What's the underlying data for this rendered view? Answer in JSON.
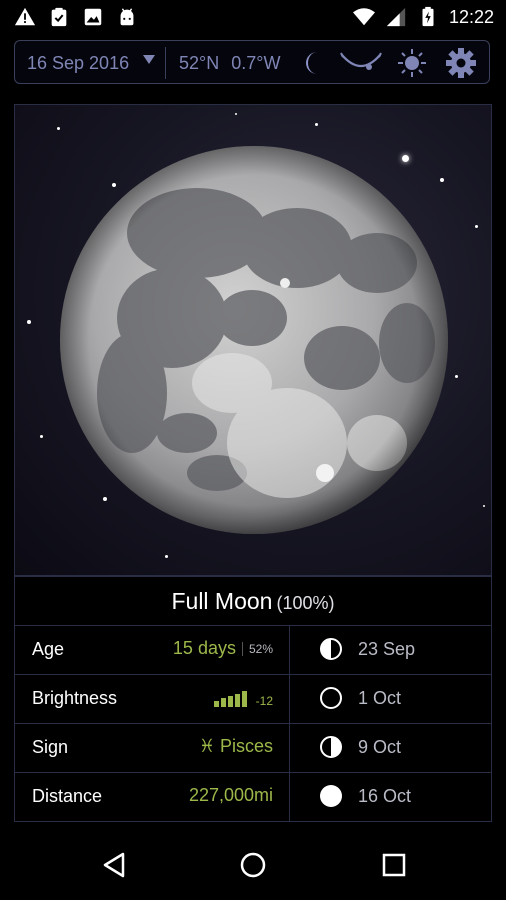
{
  "status_bar": {
    "time": "12:22",
    "left_icons": [
      "warning-icon",
      "clipboard-check-icon",
      "image-icon",
      "android-icon"
    ],
    "right_icons": [
      "wifi-icon",
      "cell-signal-icon",
      "battery-charging-icon"
    ]
  },
  "toolbar": {
    "date": "16 Sep 2016",
    "latitude": "52°N",
    "longitude": "0.7°W",
    "icons": [
      "moon-icon",
      "moon-path-icon",
      "sun-icon",
      "settings-icon"
    ]
  },
  "moon_phase": {
    "name": "Full Moon",
    "percent": "(100%)"
  },
  "rows": [
    {
      "label": "Age",
      "value": "15 days",
      "sub": "52%",
      "next_phase_icon": "first-quarter-icon",
      "next_phase_date": "23 Sep"
    },
    {
      "label": "Brightness",
      "value": "",
      "sub": "-12",
      "brightness_bars": 5,
      "next_phase_icon": "new-moon-icon",
      "next_phase_date": "1 Oct"
    },
    {
      "label": "Sign",
      "value": "♓ Pisces",
      "next_phase_icon": "last-quarter-icon",
      "next_phase_date": "9 Oct"
    },
    {
      "label": "Distance",
      "value": "227,000mi",
      "next_phase_icon": "full-moon-icon",
      "next_phase_date": "16 Oct"
    }
  ],
  "colors": {
    "accent_green": "#9db84a",
    "toolbar_text": "#7f85b5",
    "border": "#2a2e44"
  },
  "nav_bar": {
    "buttons": [
      "back-icon",
      "home-icon",
      "recents-icon"
    ]
  }
}
